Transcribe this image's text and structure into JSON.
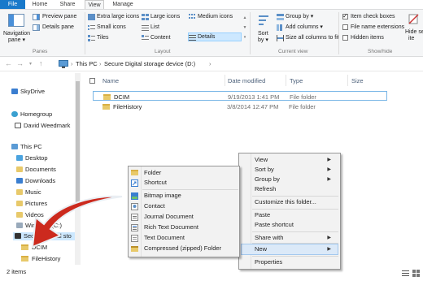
{
  "tabs": [
    "File",
    "Home",
    "Share",
    "View",
    "Manage"
  ],
  "ribbon": {
    "panes": {
      "navigation_pane": "Navigation",
      "navigation_pane_2": "pane ▾",
      "preview_pane": "Preview pane",
      "details_pane": "Details pane",
      "group_label": "Panes"
    },
    "layout": {
      "items": [
        "Extra large icons",
        "Large icons",
        "Medium icons",
        "Small icons",
        "List",
        "Details",
        "Tiles",
        "Content"
      ],
      "group_label": "Layout"
    },
    "current_view": {
      "sort_by": "Sort",
      "sort_by_2": "by ▾",
      "group_by": "Group by ▾",
      "add_columns": "Add columns ▾",
      "size_columns": "Size all columns to fit",
      "group_label": "Current view"
    },
    "show_hide": {
      "item_check_boxes": "Item check boxes",
      "file_name_extensions": "File name extensions",
      "hidden_items": "Hidden items",
      "hide_selected": "Hide se",
      "hide_selected_2": "ite",
      "group_label": "Show/hide"
    }
  },
  "address": {
    "this_pc": "This PC",
    "sep1": "›",
    "drive": "Secure Digital storage device (D:)",
    "sep2": "›"
  },
  "nav": {
    "items": [
      "SkyDrive",
      "Homegroup",
      "David Weedmark",
      "This PC",
      "Desktop",
      "Documents",
      "Downloads",
      "Music",
      "Pictures",
      "Videos",
      "Windows (C:)",
      "Secure Digital sto",
      "DCIM",
      "FileHistory"
    ]
  },
  "list": {
    "headers": [
      "Name",
      "Date modified",
      "Type",
      "Size"
    ],
    "rows": [
      {
        "name": "DCIM",
        "date": "9/19/2013 1:41 PM",
        "type": "File folder"
      },
      {
        "name": "FileHistory",
        "date": "3/8/2014 12:47 PM",
        "type": "File folder"
      }
    ]
  },
  "status": {
    "text": "2 items"
  },
  "context_menu": {
    "items": [
      "View",
      "Sort by",
      "Group by",
      "Refresh",
      "Customize this folder...",
      "Paste",
      "Paste shortcut",
      "Share with",
      "New",
      "Properties"
    ]
  },
  "new_submenu": {
    "items": [
      "Folder",
      "Shortcut",
      "Bitmap image",
      "Contact",
      "Journal Document",
      "Rich Text Document",
      "Text Document",
      "Compressed (zipped) Folder"
    ]
  },
  "colors": {
    "file_tab": "#1979ca",
    "arrow": "#cc2a1e",
    "folder": "#e8c96a",
    "selection": "#cce8ff"
  }
}
